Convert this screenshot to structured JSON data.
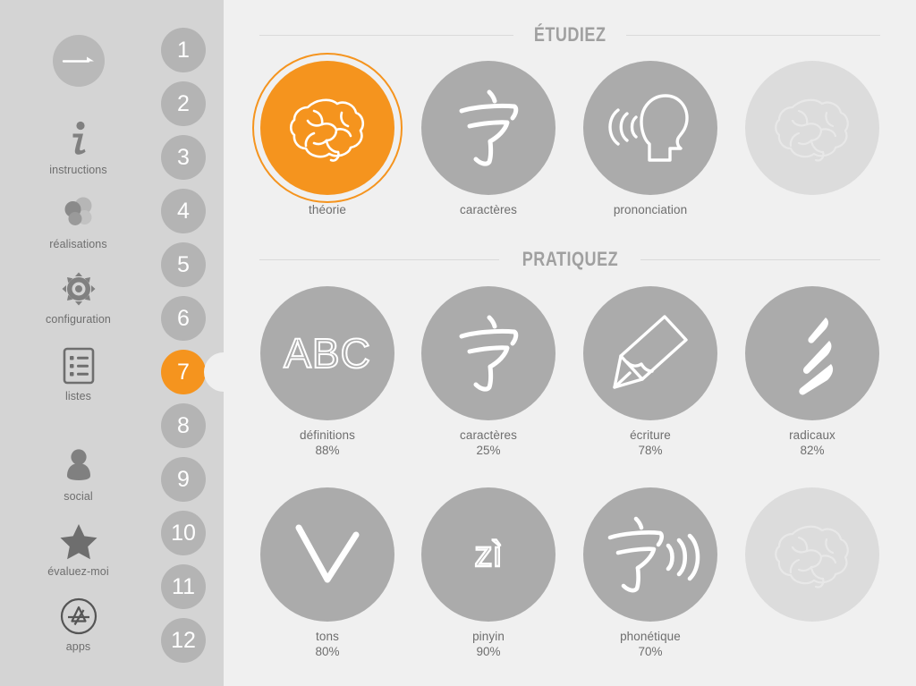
{
  "colors": {
    "accent": "#f5941e",
    "sidebar_bg": "#d4d4d4",
    "main_bg": "#f0f0f0",
    "circle_gray": "#ababab",
    "circle_disabled": "#dcdcdc",
    "number_gray": "#b4b4b4",
    "text_gray": "#6e6e6e",
    "rule_gray": "#dadada"
  },
  "sidebar": {
    "back_button": {
      "icon": "arrow-right-icon",
      "label": ""
    },
    "items": [
      {
        "icon": "info-icon",
        "label": "instructions"
      },
      {
        "icon": "bubbles-icon",
        "label": "réalisations"
      },
      {
        "icon": "gear-icon",
        "label": "configuration"
      },
      {
        "icon": "list-icon",
        "label": "listes"
      },
      {
        "icon": "person-icon",
        "label": "social"
      },
      {
        "icon": "star-icon",
        "label": "évaluez-moi"
      },
      {
        "icon": "appstore-icon",
        "label": "apps"
      }
    ],
    "numbers": [
      {
        "label": "1",
        "active": false
      },
      {
        "label": "2",
        "active": false
      },
      {
        "label": "3",
        "active": false
      },
      {
        "label": "4",
        "active": false
      },
      {
        "label": "5",
        "active": false
      },
      {
        "label": "6",
        "active": false
      },
      {
        "label": "7",
        "active": true
      },
      {
        "label": "8",
        "active": false
      },
      {
        "label": "9",
        "active": false
      },
      {
        "label": "10",
        "active": false
      },
      {
        "label": "11",
        "active": false
      },
      {
        "label": "12",
        "active": false
      }
    ]
  },
  "sections": [
    {
      "title": "ÉTUDIEZ",
      "tiles": [
        {
          "icon": "brain-icon",
          "label": "théorie",
          "percent": "",
          "state": "selected"
        },
        {
          "icon": "hanzi-icon",
          "label": "caractères",
          "percent": "",
          "state": "normal"
        },
        {
          "icon": "speak-icon",
          "label": "prononciation",
          "percent": "",
          "state": "normal"
        },
        {
          "icon": "brain-icon",
          "label": "",
          "percent": "",
          "state": "disabled"
        }
      ]
    },
    {
      "title": "PRATIQUEZ",
      "tiles": [
        {
          "icon": "abc-icon",
          "label": "définitions",
          "percent": "88%",
          "state": "normal"
        },
        {
          "icon": "hanzi-icon",
          "label": "caractères",
          "percent": "25%",
          "state": "normal"
        },
        {
          "icon": "pencil-icon",
          "label": "écriture",
          "percent": "78%",
          "state": "normal"
        },
        {
          "icon": "radical-icon",
          "label": "radicaux",
          "percent": "82%",
          "state": "normal"
        },
        {
          "icon": "chevron-down-icon",
          "label": "tons",
          "percent": "80%",
          "state": "normal"
        },
        {
          "icon": "pinyin-icon",
          "label": "pinyin",
          "percent": "90%",
          "state": "normal"
        },
        {
          "icon": "hanzi-sound-icon",
          "label": "phonétique",
          "percent": "70%",
          "state": "normal"
        },
        {
          "icon": "brain-icon",
          "label": "",
          "percent": "",
          "state": "disabled"
        }
      ]
    }
  ],
  "icon_glyphs": {
    "hanzi": "字",
    "radical": "彡",
    "abc": "ABC",
    "pinyin": "zì"
  }
}
